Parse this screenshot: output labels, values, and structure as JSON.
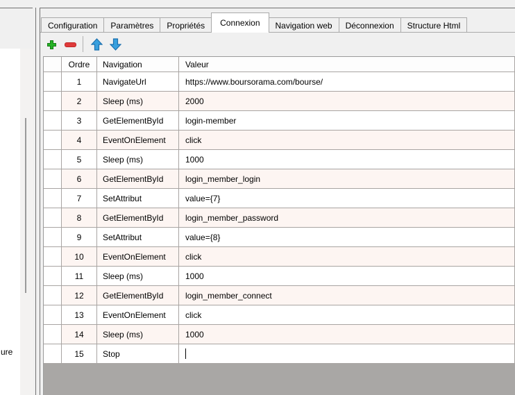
{
  "left_panel": {
    "truncated_text": "ure"
  },
  "tab_bar": {
    "tabs": [
      {
        "label": "Configuration",
        "active": false
      },
      {
        "label": "Paramètres",
        "active": false
      },
      {
        "label": "Propriétés",
        "active": false
      },
      {
        "label": "Connexion",
        "active": true
      },
      {
        "label": "Navigation web",
        "active": false
      },
      {
        "label": "Déconnexion",
        "active": false
      },
      {
        "label": "Structure Html",
        "active": false
      }
    ]
  },
  "toolbar": {
    "buttons": [
      {
        "name": "add-row",
        "icon": "plus-icon",
        "color": "#26b226"
      },
      {
        "name": "remove-row",
        "icon": "minus-icon",
        "color": "#df3b3b"
      },
      {
        "name": "move-up",
        "icon": "arrow-up-icon",
        "color": "#38a0de"
      },
      {
        "name": "move-down",
        "icon": "arrow-down-icon",
        "color": "#38a0de"
      }
    ]
  },
  "grid": {
    "columns": [
      "Ordre",
      "Navigation",
      "Valeur"
    ],
    "rows": [
      {
        "ordre": "1",
        "navigation": "NavigateUrl",
        "valeur": "https://www.boursorama.com/bourse/"
      },
      {
        "ordre": "2",
        "navigation": "Sleep (ms)",
        "valeur": "2000"
      },
      {
        "ordre": "3",
        "navigation": "GetElementById",
        "valeur": "login-member"
      },
      {
        "ordre": "4",
        "navigation": "EventOnElement",
        "valeur": "click"
      },
      {
        "ordre": "5",
        "navigation": "Sleep (ms)",
        "valeur": "1000"
      },
      {
        "ordre": "6",
        "navigation": "GetElementById",
        "valeur": "login_member_login"
      },
      {
        "ordre": "7",
        "navigation": "SetAttribut",
        "valeur": "value={7}"
      },
      {
        "ordre": "8",
        "navigation": "GetElementById",
        "valeur": "login_member_password"
      },
      {
        "ordre": "9",
        "navigation": "SetAttribut",
        "valeur": "value={8}"
      },
      {
        "ordre": "10",
        "navigation": "EventOnElement",
        "valeur": "click"
      },
      {
        "ordre": "11",
        "navigation": "Sleep (ms)",
        "valeur": "1000"
      },
      {
        "ordre": "12",
        "navigation": "GetElementById",
        "valeur": "login_member_connect"
      },
      {
        "ordre": "13",
        "navigation": "EventOnElement",
        "valeur": "click"
      },
      {
        "ordre": "14",
        "navigation": "Sleep (ms)",
        "valeur": "1000"
      },
      {
        "ordre": "15",
        "navigation": "Stop",
        "valeur": ""
      }
    ],
    "editing_row": 15,
    "colors": {
      "alt_row": "#fdf5f2",
      "grid_line": "#a8a4a2",
      "empty_background": "#a9a7a5"
    }
  }
}
